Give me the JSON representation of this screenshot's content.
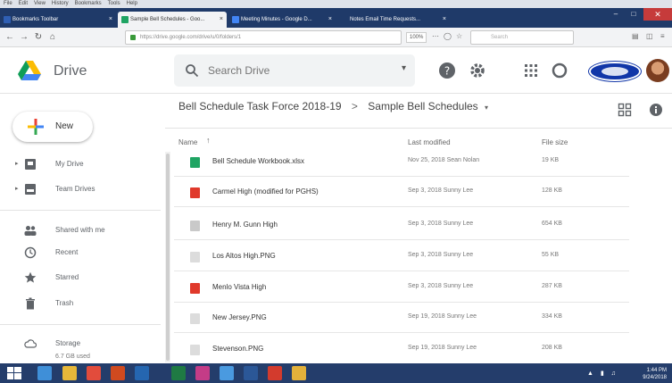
{
  "browser": {
    "menu": [
      "File",
      "Edit",
      "View",
      "History",
      "Bookmarks",
      "Tools",
      "Help"
    ],
    "tabs": [
      {
        "label": "Bookmarks Toolbar",
        "color": "#2f5fb4",
        "active": false
      },
      {
        "label": "Sample Bell Schedules - Goo...",
        "color": "#1fa463",
        "active": true
      },
      {
        "label": "Meeting Minutes - Google D...",
        "color": "#4285f4",
        "active": false
      },
      {
        "label": "Notes Email Time Requests...",
        "color": "#1f3a69",
        "active": false
      }
    ],
    "url": "https://drive.google.com/drive/u/0/folders/1",
    "zoom": "100%",
    "search_placeholder": "Search"
  },
  "drive": {
    "title": "Drive",
    "search_placeholder": "Search Drive",
    "new_label": "New"
  },
  "sidebar": {
    "items": [
      {
        "label": "My Drive",
        "icon": "my-drive-icon",
        "expandable": true
      },
      {
        "label": "Team Drives",
        "icon": "team-drives-icon",
        "expandable": true
      },
      {
        "label": "Shared with me",
        "icon": "shared-icon",
        "expandable": false
      },
      {
        "label": "Recent",
        "icon": "recent-icon",
        "expandable": false
      },
      {
        "label": "Starred",
        "icon": "star-icon",
        "expandable": false
      },
      {
        "label": "Trash",
        "icon": "trash-icon",
        "expandable": false
      },
      {
        "label": "Storage",
        "icon": "cloud-icon",
        "expandable": false
      }
    ],
    "storage_used": "6.7 GB used"
  },
  "breadcrumb": {
    "parent": "Bell Schedule Task Force 2018-19",
    "separator": ">",
    "current": "Sample Bell Schedules"
  },
  "table": {
    "columns": {
      "name": "Name",
      "modified": "Last modified",
      "size": "File size"
    },
    "rows": [
      {
        "name": "Bell Schedule Workbook.xlsx",
        "modified": "Nov 25, 2018 Sean Nolan",
        "size": "19 KB",
        "type": "sheets",
        "color": "#1fa463"
      },
      {
        "name": "Carmel High (modified for PGHS)",
        "modified": "Sep 3, 2018 Sunny Lee",
        "size": "128 KB",
        "type": "pdf",
        "color": "#e0392b"
      },
      {
        "name": "Henry M. Gunn High",
        "modified": "Sep 3, 2018 Sunny Lee",
        "size": "654 KB",
        "type": "image",
        "color": "#c9c9c9"
      },
      {
        "name": "Los Altos High.PNG",
        "modified": "Sep 3, 2018 Sunny Lee",
        "size": "55 KB",
        "type": "image",
        "color": "#dcdcdc"
      },
      {
        "name": "Menlo Vista High",
        "modified": "Sep 3, 2018 Sunny Lee",
        "size": "287 KB",
        "type": "pdf",
        "color": "#e0392b"
      },
      {
        "name": "New Jersey.PNG",
        "modified": "Sep 19, 2018 Sunny Lee",
        "size": "334 KB",
        "type": "image",
        "color": "#dcdcdc"
      },
      {
        "name": "Stevenson.PNG",
        "modified": "Sep 19, 2018 Sunny Lee",
        "size": "208 KB",
        "type": "image",
        "color": "#dcdcdc"
      }
    ]
  },
  "taskbar": {
    "apps": [
      {
        "name": "ie",
        "color": "#3f8fd8"
      },
      {
        "name": "folder",
        "color": "#e7b83a"
      },
      {
        "name": "chrome",
        "color": "#e24c3c"
      },
      {
        "name": "powerpoint",
        "color": "#d04a1f"
      },
      {
        "name": "outlook",
        "color": "#2566b0"
      },
      {
        "name": "excel",
        "color": "#1f7a43"
      },
      {
        "name": "photos",
        "color": "#c43c87"
      },
      {
        "name": "chrome-2",
        "color": "#4a9ae0"
      },
      {
        "name": "word",
        "color": "#2b5797"
      },
      {
        "name": "acrobat",
        "color": "#d33b2d"
      },
      {
        "name": "explorer",
        "color": "#e3b13b"
      }
    ],
    "time": "1:44 PM",
    "date": "9/24/2018"
  }
}
